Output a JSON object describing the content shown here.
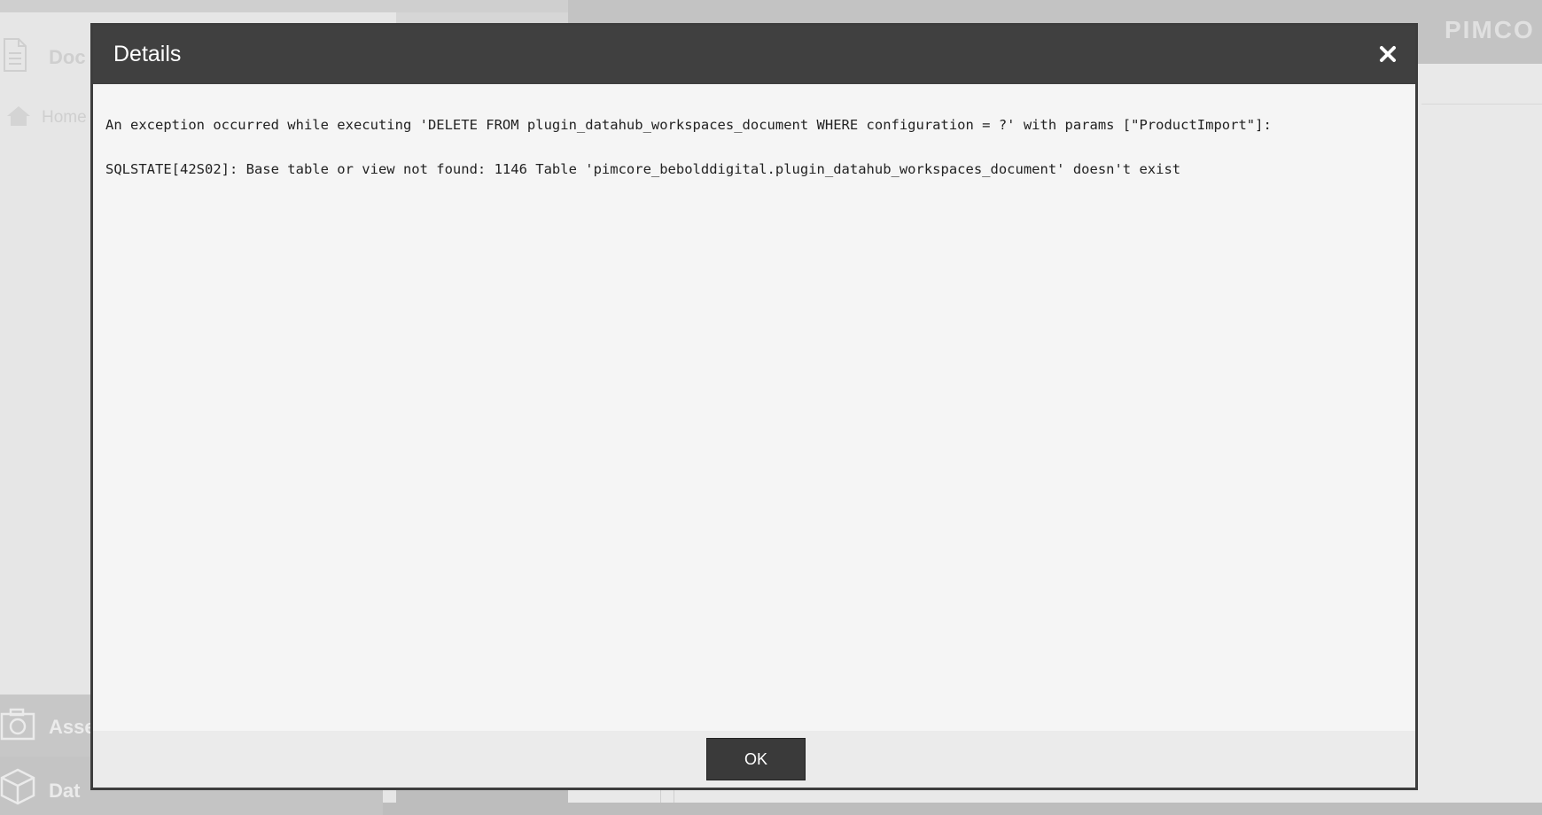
{
  "background": {
    "brand": "PIMCO",
    "sidebar": {
      "documents_label": "Doc",
      "home_label": "Home",
      "assets_label": "Asse",
      "data_label": "Dat"
    }
  },
  "dialog": {
    "title": "Details",
    "message_line_1": "An exception occurred while executing 'DELETE FROM plugin_datahub_workspaces_document WHERE configuration = ?' with params [\"ProductImport\"]:",
    "message_line_2": "SQLSTATE[42S02]: Base table or view not found: 1146 Table 'pimcore_bebolddigital.plugin_datahub_workspaces_document' doesn't exist",
    "ok_label": "OK",
    "close_icon": "close-icon"
  },
  "colors": {
    "dialog_header": "#404040",
    "dialog_body": "#f5f5f5",
    "button": "#3a3a3a"
  }
}
